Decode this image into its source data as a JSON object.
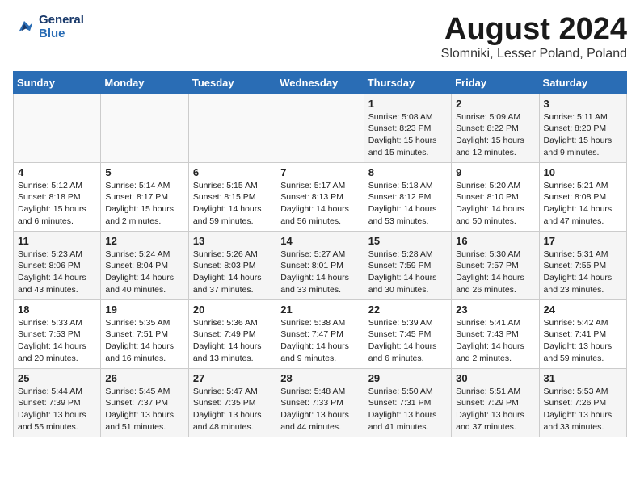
{
  "logo": {
    "line1": "General",
    "line2": "Blue"
  },
  "title": "August 2024",
  "subtitle": "Slomniki, Lesser Poland, Poland",
  "weekdays": [
    "Sunday",
    "Monday",
    "Tuesday",
    "Wednesday",
    "Thursday",
    "Friday",
    "Saturday"
  ],
  "weeks": [
    [
      {
        "day": "",
        "info": ""
      },
      {
        "day": "",
        "info": ""
      },
      {
        "day": "",
        "info": ""
      },
      {
        "day": "",
        "info": ""
      },
      {
        "day": "1",
        "info": "Sunrise: 5:08 AM\nSunset: 8:23 PM\nDaylight: 15 hours\nand 15 minutes."
      },
      {
        "day": "2",
        "info": "Sunrise: 5:09 AM\nSunset: 8:22 PM\nDaylight: 15 hours\nand 12 minutes."
      },
      {
        "day": "3",
        "info": "Sunrise: 5:11 AM\nSunset: 8:20 PM\nDaylight: 15 hours\nand 9 minutes."
      }
    ],
    [
      {
        "day": "4",
        "info": "Sunrise: 5:12 AM\nSunset: 8:18 PM\nDaylight: 15 hours\nand 6 minutes."
      },
      {
        "day": "5",
        "info": "Sunrise: 5:14 AM\nSunset: 8:17 PM\nDaylight: 15 hours\nand 2 minutes."
      },
      {
        "day": "6",
        "info": "Sunrise: 5:15 AM\nSunset: 8:15 PM\nDaylight: 14 hours\nand 59 minutes."
      },
      {
        "day": "7",
        "info": "Sunrise: 5:17 AM\nSunset: 8:13 PM\nDaylight: 14 hours\nand 56 minutes."
      },
      {
        "day": "8",
        "info": "Sunrise: 5:18 AM\nSunset: 8:12 PM\nDaylight: 14 hours\nand 53 minutes."
      },
      {
        "day": "9",
        "info": "Sunrise: 5:20 AM\nSunset: 8:10 PM\nDaylight: 14 hours\nand 50 minutes."
      },
      {
        "day": "10",
        "info": "Sunrise: 5:21 AM\nSunset: 8:08 PM\nDaylight: 14 hours\nand 47 minutes."
      }
    ],
    [
      {
        "day": "11",
        "info": "Sunrise: 5:23 AM\nSunset: 8:06 PM\nDaylight: 14 hours\nand 43 minutes."
      },
      {
        "day": "12",
        "info": "Sunrise: 5:24 AM\nSunset: 8:04 PM\nDaylight: 14 hours\nand 40 minutes."
      },
      {
        "day": "13",
        "info": "Sunrise: 5:26 AM\nSunset: 8:03 PM\nDaylight: 14 hours\nand 37 minutes."
      },
      {
        "day": "14",
        "info": "Sunrise: 5:27 AM\nSunset: 8:01 PM\nDaylight: 14 hours\nand 33 minutes."
      },
      {
        "day": "15",
        "info": "Sunrise: 5:28 AM\nSunset: 7:59 PM\nDaylight: 14 hours\nand 30 minutes."
      },
      {
        "day": "16",
        "info": "Sunrise: 5:30 AM\nSunset: 7:57 PM\nDaylight: 14 hours\nand 26 minutes."
      },
      {
        "day": "17",
        "info": "Sunrise: 5:31 AM\nSunset: 7:55 PM\nDaylight: 14 hours\nand 23 minutes."
      }
    ],
    [
      {
        "day": "18",
        "info": "Sunrise: 5:33 AM\nSunset: 7:53 PM\nDaylight: 14 hours\nand 20 minutes."
      },
      {
        "day": "19",
        "info": "Sunrise: 5:35 AM\nSunset: 7:51 PM\nDaylight: 14 hours\nand 16 minutes."
      },
      {
        "day": "20",
        "info": "Sunrise: 5:36 AM\nSunset: 7:49 PM\nDaylight: 14 hours\nand 13 minutes."
      },
      {
        "day": "21",
        "info": "Sunrise: 5:38 AM\nSunset: 7:47 PM\nDaylight: 14 hours\nand 9 minutes."
      },
      {
        "day": "22",
        "info": "Sunrise: 5:39 AM\nSunset: 7:45 PM\nDaylight: 14 hours\nand 6 minutes."
      },
      {
        "day": "23",
        "info": "Sunrise: 5:41 AM\nSunset: 7:43 PM\nDaylight: 14 hours\nand 2 minutes."
      },
      {
        "day": "24",
        "info": "Sunrise: 5:42 AM\nSunset: 7:41 PM\nDaylight: 13 hours\nand 59 minutes."
      }
    ],
    [
      {
        "day": "25",
        "info": "Sunrise: 5:44 AM\nSunset: 7:39 PM\nDaylight: 13 hours\nand 55 minutes."
      },
      {
        "day": "26",
        "info": "Sunrise: 5:45 AM\nSunset: 7:37 PM\nDaylight: 13 hours\nand 51 minutes."
      },
      {
        "day": "27",
        "info": "Sunrise: 5:47 AM\nSunset: 7:35 PM\nDaylight: 13 hours\nand 48 minutes."
      },
      {
        "day": "28",
        "info": "Sunrise: 5:48 AM\nSunset: 7:33 PM\nDaylight: 13 hours\nand 44 minutes."
      },
      {
        "day": "29",
        "info": "Sunrise: 5:50 AM\nSunset: 7:31 PM\nDaylight: 13 hours\nand 41 minutes."
      },
      {
        "day": "30",
        "info": "Sunrise: 5:51 AM\nSunset: 7:29 PM\nDaylight: 13 hours\nand 37 minutes."
      },
      {
        "day": "31",
        "info": "Sunrise: 5:53 AM\nSunset: 7:26 PM\nDaylight: 13 hours\nand 33 minutes."
      }
    ]
  ]
}
